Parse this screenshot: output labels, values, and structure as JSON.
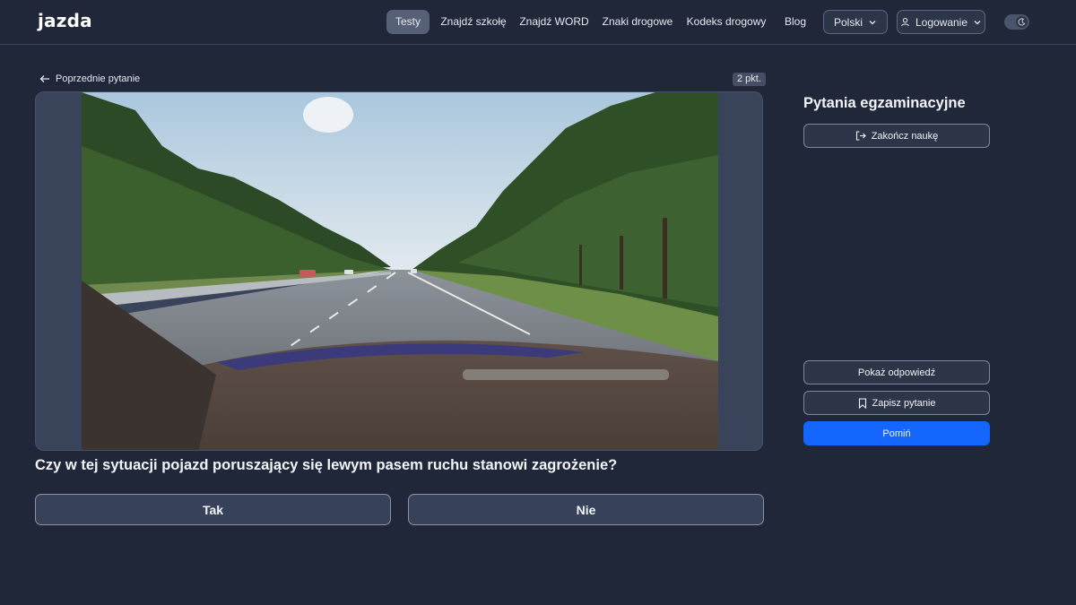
{
  "header": {
    "logo": "jazda",
    "nav": [
      {
        "label": "Testy",
        "active": true
      },
      {
        "label": "Znajdź szkołę",
        "active": false
      },
      {
        "label": "Znajdź WORD",
        "active": false
      },
      {
        "label": "Znaki drogowe",
        "active": false
      },
      {
        "label": "Kodeks drogowy",
        "active": false
      },
      {
        "label": "Blog",
        "active": false
      }
    ],
    "language_label": "Polski",
    "login_label": "Logowanie",
    "theme_toggle_icon": "moon-icon"
  },
  "question": {
    "prev_label": "Poprzednie pytanie",
    "points": "2 pkt.",
    "text": "Czy w tej sytuacji pojazd poruszający się lewym pasem ruchu stanowi zagrożenie?",
    "answers": [
      "Tak",
      "Nie"
    ]
  },
  "sidebar": {
    "title": "Pytania egzaminacyjne",
    "end_label": "Zakończ naukę",
    "show_answer_label": "Pokaż odpowiedź",
    "save_label": "Zapisz pytanie",
    "skip_label": "Pomiń"
  },
  "colors": {
    "background": "#1f2738",
    "accent": "#1565ff",
    "nav_active": "#566178"
  }
}
